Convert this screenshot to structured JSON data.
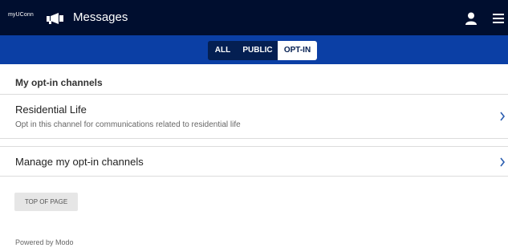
{
  "header": {
    "brand": "myUConn",
    "title": "Messages",
    "bg_color": "#000e2f"
  },
  "tabs": [
    {
      "label": "ALL",
      "active": false
    },
    {
      "label": "PUBLIC",
      "active": false
    },
    {
      "label": "OPT-IN",
      "active": true
    }
  ],
  "tabbar_color": "#0b3fa5",
  "section": {
    "title": "My opt-in channels"
  },
  "channels": [
    {
      "title": "Residential Life",
      "description": "Opt in this channel for communications related to residential life"
    }
  ],
  "manage": {
    "label": "Manage my opt-in channels"
  },
  "top_button": {
    "label": "TOP OF PAGE"
  },
  "footer": {
    "text": "Powered by Modo"
  },
  "icons": {
    "megaphone": "megaphone-icon",
    "user": "user-icon",
    "menu": "menu-icon",
    "chevron": "chevron-right-icon"
  }
}
